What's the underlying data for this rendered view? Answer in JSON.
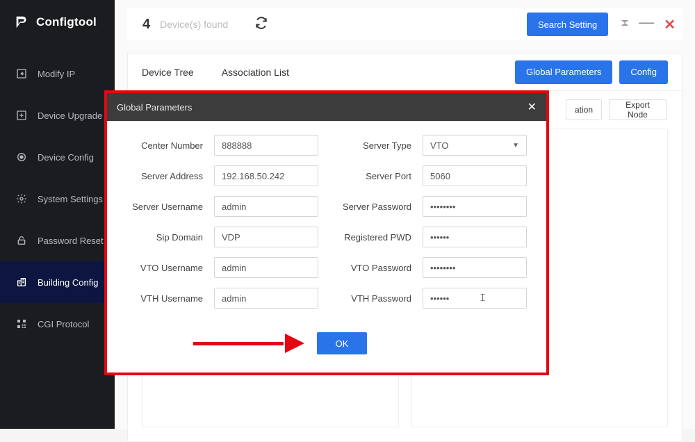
{
  "app": {
    "title": "Configtool"
  },
  "sidebar": {
    "items": [
      {
        "label": "Modify IP",
        "icon": "square-return-icon"
      },
      {
        "label": "Device Upgrade",
        "icon": "square-plus-icon"
      },
      {
        "label": "Device Config",
        "icon": "target-icon"
      },
      {
        "label": "System Settings",
        "icon": "gear-icon"
      },
      {
        "label": "Password Reset",
        "icon": "lock-icon"
      },
      {
        "label": "Building Config",
        "icon": "building-icon"
      },
      {
        "label": "CGI Protocol",
        "icon": "qr-icon"
      }
    ],
    "active_index": 5
  },
  "topbar": {
    "count": "4",
    "found_label": "Device(s) found",
    "search_setting_label": "Search Setting"
  },
  "tabs": {
    "device_tree_label": "Device Tree",
    "association_list_label": "Association List",
    "global_parameters_label": "Global Parameters",
    "config_label": "Config"
  },
  "tools": {
    "button_partial_label": "ation",
    "export_node_label": "Export Node"
  },
  "modal": {
    "title": "Global Parameters",
    "labels": {
      "center_number": "Center Number",
      "server_type": "Server Type",
      "server_address": "Server Address",
      "server_port": "Server Port",
      "server_username": "Server Username",
      "server_password": "Server Password",
      "sip_domain": "Sip Domain",
      "registered_pwd": "Registered PWD",
      "vto_username": "VTO Username",
      "vto_password": "VTO Password",
      "vth_username": "VTH Username",
      "vth_password": "VTH Password"
    },
    "values": {
      "center_number": "888888",
      "server_type": "VTO",
      "server_address": "192.168.50.242",
      "server_port": "5060",
      "server_username": "admin",
      "server_password": "••••••••",
      "sip_domain": "VDP",
      "registered_pwd": "••••••",
      "vto_username": "admin",
      "vto_password": "••••••••",
      "vth_username": "admin",
      "vth_password": "••••••"
    },
    "ok_label": "OK"
  },
  "colors": {
    "accent": "#2a74ea",
    "sidebar_bg": "#1a1c20",
    "annotation": "#e30613"
  }
}
